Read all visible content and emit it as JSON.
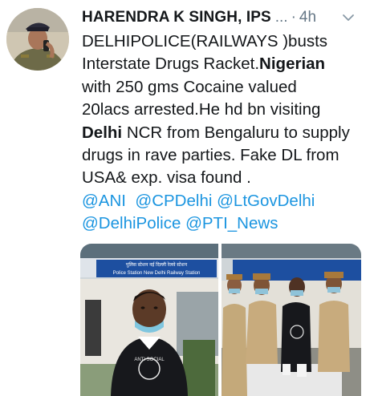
{
  "tweet": {
    "author": {
      "name": "HARENDRA K SINGH, IPS",
      "ellipsis": "...",
      "separator": "·",
      "time": "4h"
    },
    "text": {
      "line1": "DELHIPOLICE(RAILWAYS )busts",
      "line2": "Interstate Drugs Racket.",
      "line2_bold": "Nigerian",
      "line3": "with 250 gms Cocaine valued",
      "line4": "20lacs arrested.He hd bn visiting",
      "line5_bold": "Delhi",
      "line5": " NCR from Bengaluru to supply",
      "line6": "drugs in rave parties. Fake DL from",
      "line7": "USA& exp. visa found ."
    },
    "mentions": [
      "@ANI",
      "@CPDelhi",
      "@LtGovDelhi",
      "@DelhiPolice",
      "@PTI_News"
    ],
    "media": {
      "sign_hindi": "पुलिस स्टेशन नई दिल्ली रेलवे स्टेशन",
      "sign_english": "Police Station New Delhi Railway Station",
      "tshirt_text": "ANTI SOCIAL"
    }
  },
  "colors": {
    "link": "#1b95e0",
    "muted": "#657786",
    "text": "#14171a"
  },
  "icons": {
    "menu": "chevron-down-icon"
  }
}
